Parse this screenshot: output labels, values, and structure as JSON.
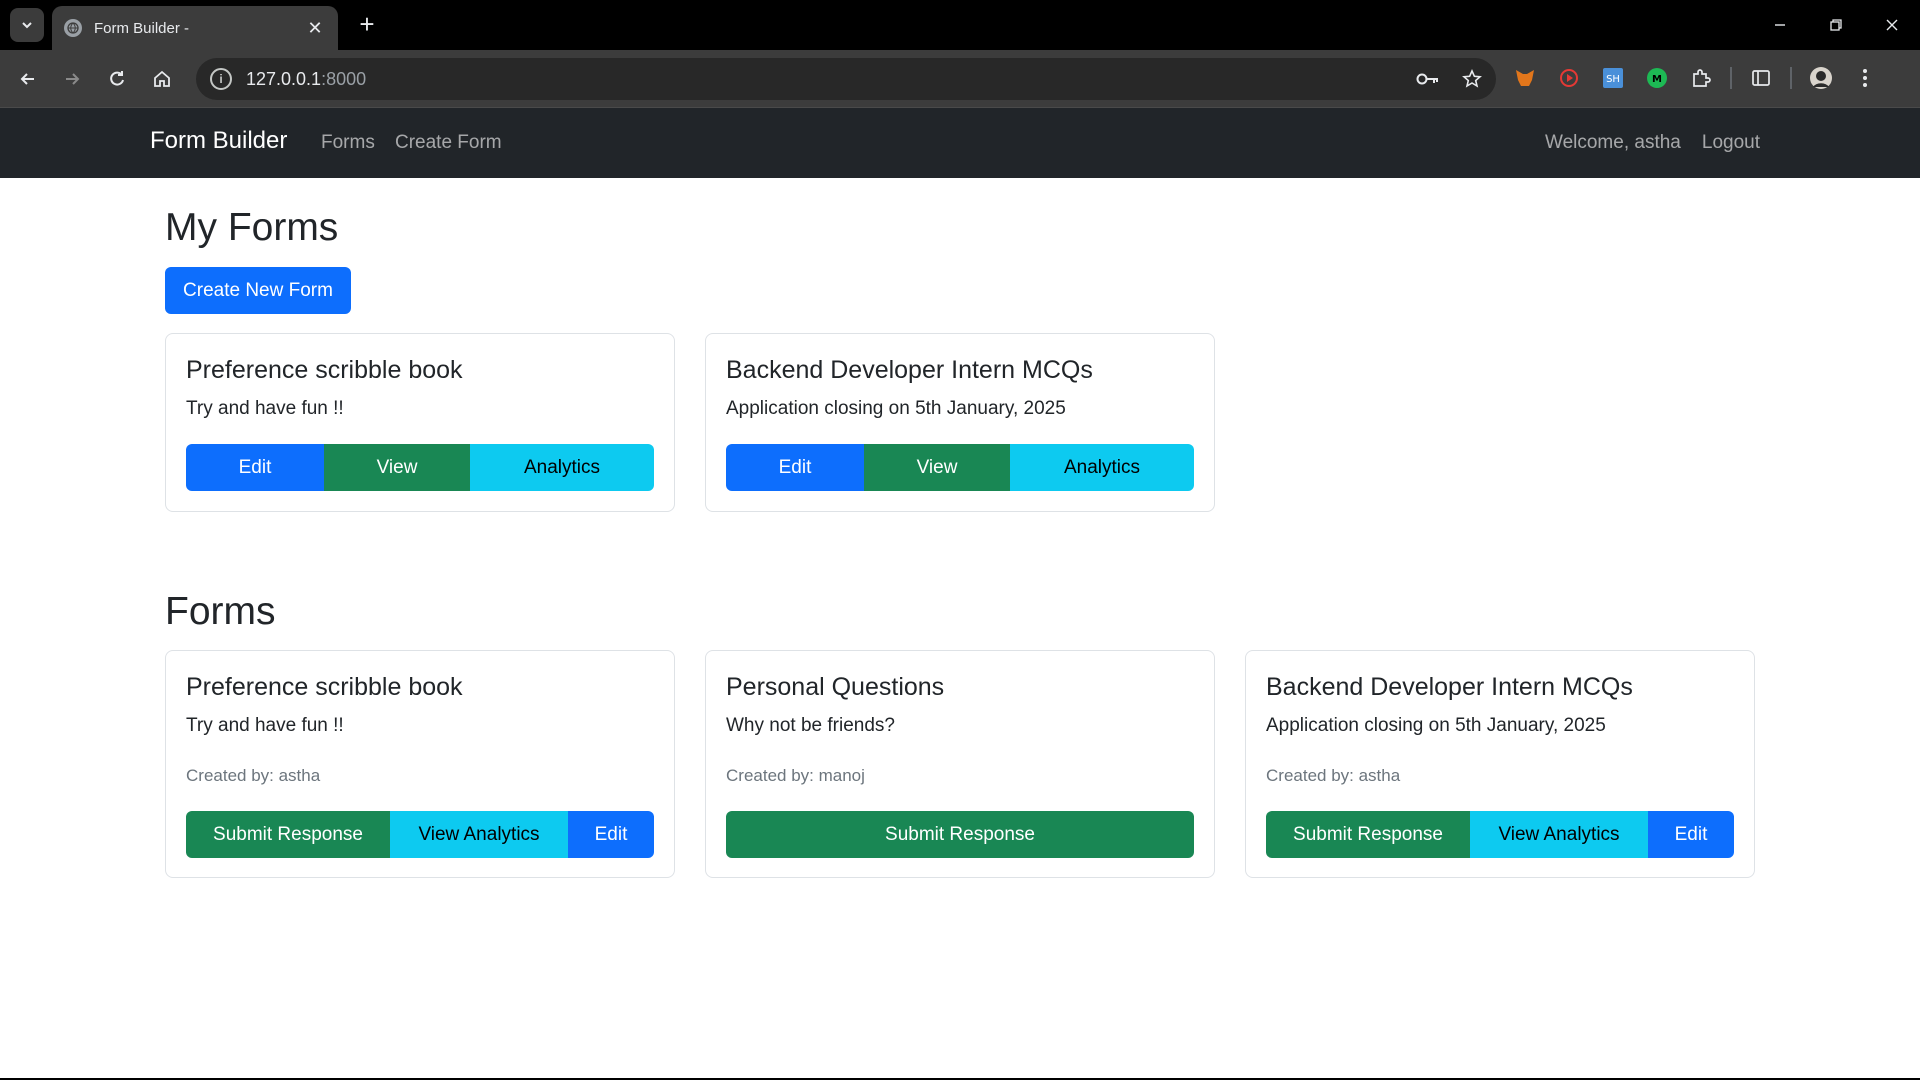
{
  "browser": {
    "tab_title": "Form Builder -",
    "url_host": "127.0.0.1",
    "url_port": ":8000"
  },
  "navbar": {
    "brand": "Form Builder",
    "links": [
      "Forms",
      "Create Form"
    ],
    "welcome": "Welcome, astha",
    "logout": "Logout"
  },
  "my_forms": {
    "heading": "My Forms",
    "create_button": "Create New Form",
    "cards": [
      {
        "title": "Preference scribble book",
        "description": "Try and have fun !!",
        "buttons": [
          "Edit",
          "View",
          "Analytics"
        ]
      },
      {
        "title": "Backend Developer Intern MCQs",
        "description": "Application closing on 5th January, 2025",
        "buttons": [
          "Edit",
          "View",
          "Analytics"
        ]
      }
    ]
  },
  "forms": {
    "heading": "Forms",
    "cards": [
      {
        "title": "Preference scribble book",
        "description": "Try and have fun !!",
        "created_by": "Created by: astha",
        "buttons": [
          "Submit Response",
          "View Analytics",
          "Edit"
        ]
      },
      {
        "title": "Personal Questions",
        "description": "Why not be friends?",
        "created_by": "Created by: manoj",
        "buttons": [
          "Submit Response"
        ]
      },
      {
        "title": "Backend Developer Intern MCQs",
        "description": "Application closing on 5th January, 2025",
        "created_by": "Created by: astha",
        "buttons": [
          "Submit Response",
          "View Analytics",
          "Edit"
        ]
      }
    ]
  },
  "colors": {
    "primary": "#0d6efd",
    "success": "#198754",
    "info": "#0dcaf0",
    "navbar_bg": "#212529"
  }
}
